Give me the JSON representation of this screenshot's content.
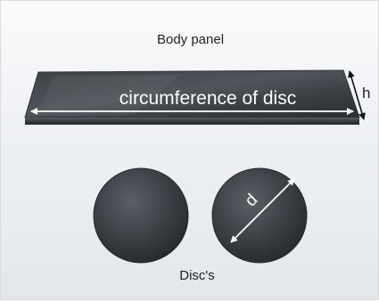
{
  "labels": {
    "panel_title": "Body panel",
    "circumference": "circumference of disc",
    "height": "h",
    "diameter": "d",
    "discs_caption": "Disc's"
  },
  "colors": {
    "background_top": "#fbfbfc",
    "background_bottom": "#e3e7ec",
    "metal_dark": "#2c3033",
    "metal_mid": "#4b5156",
    "metal_light": "#737a80",
    "arrow_white": "#ffffff",
    "arrow_black": "#111111"
  }
}
